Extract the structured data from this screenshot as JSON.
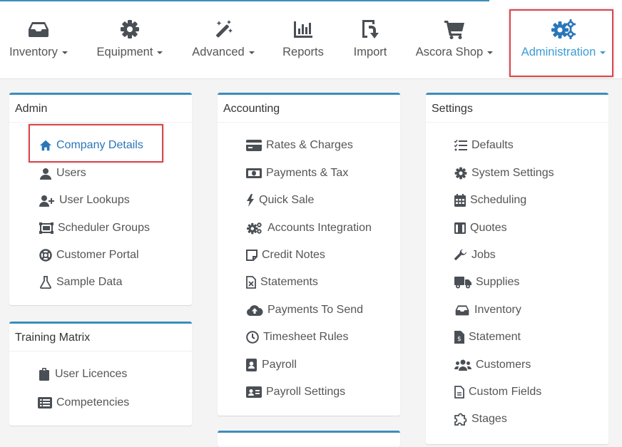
{
  "colors": {
    "accent": "#3c8dbc",
    "active_nav": "#3c9cd6",
    "highlight": "#e0434a",
    "icon": "#4a4f55"
  },
  "nav": [
    {
      "label": "Inventory",
      "icon": "inbox-tray-icon",
      "dropdown": true
    },
    {
      "label": "Equipment",
      "icon": "gear-icon",
      "dropdown": true
    },
    {
      "label": "Advanced",
      "icon": "magic-wand-icon",
      "dropdown": true
    },
    {
      "label": "Reports",
      "icon": "bar-chart-icon",
      "dropdown": false
    },
    {
      "label": "Import",
      "icon": "import-icon",
      "dropdown": false
    },
    {
      "label": "Ascora Shop",
      "icon": "shopping-cart-icon",
      "dropdown": true
    },
    {
      "label": "Administration",
      "icon": "gears-icon",
      "dropdown": true,
      "active": true
    }
  ],
  "panels": {
    "admin": {
      "title": "Admin",
      "items": [
        {
          "label": "Company Details",
          "icon": "home-icon"
        },
        {
          "label": "Users",
          "icon": "user-icon"
        },
        {
          "label": "User Lookups",
          "icon": "user-plus-icon"
        },
        {
          "label": "Scheduler Groups",
          "icon": "object-group-icon"
        },
        {
          "label": "Customer Portal",
          "icon": "life-ring-icon"
        },
        {
          "label": "Sample Data",
          "icon": "flask-icon"
        }
      ]
    },
    "training": {
      "title": "Training Matrix",
      "items": [
        {
          "label": "User Licences",
          "icon": "badge-icon"
        },
        {
          "label": "Competencies",
          "icon": "list-alt-icon"
        }
      ]
    },
    "accounting": {
      "title": "Accounting",
      "items": [
        {
          "label": "Rates & Charges",
          "icon": "credit-card-icon"
        },
        {
          "label": "Payments & Tax",
          "icon": "money-bill-icon"
        },
        {
          "label": "Quick Sale",
          "icon": "bolt-icon"
        },
        {
          "label": "Accounts Integration",
          "icon": "cogs-icon"
        },
        {
          "label": "Credit Notes",
          "icon": "sticky-note-icon"
        },
        {
          "label": "Statements",
          "icon": "excel-file-icon"
        },
        {
          "label": "Payments To Send",
          "icon": "cloud-upload-icon"
        },
        {
          "label": "Timesheet Rules",
          "icon": "clock-icon"
        },
        {
          "label": "Payroll",
          "icon": "address-book-icon"
        },
        {
          "label": "Payroll Settings",
          "icon": "id-card-icon"
        }
      ]
    },
    "settings": {
      "title": "Settings",
      "items": [
        {
          "label": "Defaults",
          "icon": "tasks-icon"
        },
        {
          "label": "System Settings",
          "icon": "gear-icon"
        },
        {
          "label": "Scheduling",
          "icon": "calendar-icon"
        },
        {
          "label": "Quotes",
          "icon": "columns-icon"
        },
        {
          "label": "Jobs",
          "icon": "wrench-icon"
        },
        {
          "label": "Supplies",
          "icon": "truck-icon"
        },
        {
          "label": "Inventory",
          "icon": "inbox-tray-icon"
        },
        {
          "label": "Statement",
          "icon": "invoice-file-icon"
        },
        {
          "label": "Customers",
          "icon": "users-icon"
        },
        {
          "label": "Custom Fields",
          "icon": "file-icon"
        },
        {
          "label": "Stages",
          "icon": "puzzle-icon"
        }
      ]
    }
  }
}
